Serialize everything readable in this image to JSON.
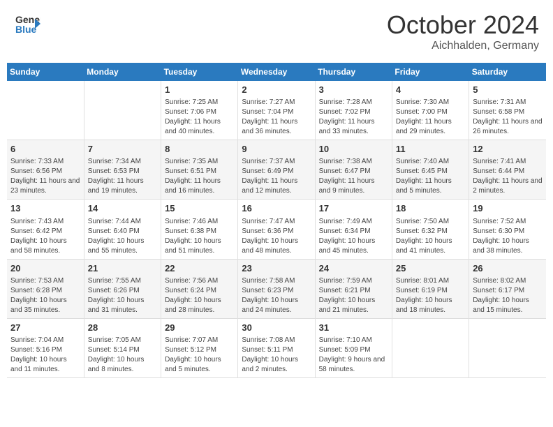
{
  "header": {
    "logo_general": "General",
    "logo_blue": "Blue",
    "title": "October 2024",
    "location": "Aichhalden, Germany"
  },
  "columns": [
    "Sunday",
    "Monday",
    "Tuesday",
    "Wednesday",
    "Thursday",
    "Friday",
    "Saturday"
  ],
  "weeks": [
    [
      {
        "day": "",
        "info": ""
      },
      {
        "day": "",
        "info": ""
      },
      {
        "day": "1",
        "info": "Sunrise: 7:25 AM\nSunset: 7:06 PM\nDaylight: 11 hours and 40 minutes."
      },
      {
        "day": "2",
        "info": "Sunrise: 7:27 AM\nSunset: 7:04 PM\nDaylight: 11 hours and 36 minutes."
      },
      {
        "day": "3",
        "info": "Sunrise: 7:28 AM\nSunset: 7:02 PM\nDaylight: 11 hours and 33 minutes."
      },
      {
        "day": "4",
        "info": "Sunrise: 7:30 AM\nSunset: 7:00 PM\nDaylight: 11 hours and 29 minutes."
      },
      {
        "day": "5",
        "info": "Sunrise: 7:31 AM\nSunset: 6:58 PM\nDaylight: 11 hours and 26 minutes."
      }
    ],
    [
      {
        "day": "6",
        "info": "Sunrise: 7:33 AM\nSunset: 6:56 PM\nDaylight: 11 hours and 23 minutes."
      },
      {
        "day": "7",
        "info": "Sunrise: 7:34 AM\nSunset: 6:53 PM\nDaylight: 11 hours and 19 minutes."
      },
      {
        "day": "8",
        "info": "Sunrise: 7:35 AM\nSunset: 6:51 PM\nDaylight: 11 hours and 16 minutes."
      },
      {
        "day": "9",
        "info": "Sunrise: 7:37 AM\nSunset: 6:49 PM\nDaylight: 11 hours and 12 minutes."
      },
      {
        "day": "10",
        "info": "Sunrise: 7:38 AM\nSunset: 6:47 PM\nDaylight: 11 hours and 9 minutes."
      },
      {
        "day": "11",
        "info": "Sunrise: 7:40 AM\nSunset: 6:45 PM\nDaylight: 11 hours and 5 minutes."
      },
      {
        "day": "12",
        "info": "Sunrise: 7:41 AM\nSunset: 6:44 PM\nDaylight: 11 hours and 2 minutes."
      }
    ],
    [
      {
        "day": "13",
        "info": "Sunrise: 7:43 AM\nSunset: 6:42 PM\nDaylight: 10 hours and 58 minutes."
      },
      {
        "day": "14",
        "info": "Sunrise: 7:44 AM\nSunset: 6:40 PM\nDaylight: 10 hours and 55 minutes."
      },
      {
        "day": "15",
        "info": "Sunrise: 7:46 AM\nSunset: 6:38 PM\nDaylight: 10 hours and 51 minutes."
      },
      {
        "day": "16",
        "info": "Sunrise: 7:47 AM\nSunset: 6:36 PM\nDaylight: 10 hours and 48 minutes."
      },
      {
        "day": "17",
        "info": "Sunrise: 7:49 AM\nSunset: 6:34 PM\nDaylight: 10 hours and 45 minutes."
      },
      {
        "day": "18",
        "info": "Sunrise: 7:50 AM\nSunset: 6:32 PM\nDaylight: 10 hours and 41 minutes."
      },
      {
        "day": "19",
        "info": "Sunrise: 7:52 AM\nSunset: 6:30 PM\nDaylight: 10 hours and 38 minutes."
      }
    ],
    [
      {
        "day": "20",
        "info": "Sunrise: 7:53 AM\nSunset: 6:28 PM\nDaylight: 10 hours and 35 minutes."
      },
      {
        "day": "21",
        "info": "Sunrise: 7:55 AM\nSunset: 6:26 PM\nDaylight: 10 hours and 31 minutes."
      },
      {
        "day": "22",
        "info": "Sunrise: 7:56 AM\nSunset: 6:24 PM\nDaylight: 10 hours and 28 minutes."
      },
      {
        "day": "23",
        "info": "Sunrise: 7:58 AM\nSunset: 6:23 PM\nDaylight: 10 hours and 24 minutes."
      },
      {
        "day": "24",
        "info": "Sunrise: 7:59 AM\nSunset: 6:21 PM\nDaylight: 10 hours and 21 minutes."
      },
      {
        "day": "25",
        "info": "Sunrise: 8:01 AM\nSunset: 6:19 PM\nDaylight: 10 hours and 18 minutes."
      },
      {
        "day": "26",
        "info": "Sunrise: 8:02 AM\nSunset: 6:17 PM\nDaylight: 10 hours and 15 minutes."
      }
    ],
    [
      {
        "day": "27",
        "info": "Sunrise: 7:04 AM\nSunset: 5:16 PM\nDaylight: 10 hours and 11 minutes."
      },
      {
        "day": "28",
        "info": "Sunrise: 7:05 AM\nSunset: 5:14 PM\nDaylight: 10 hours and 8 minutes."
      },
      {
        "day": "29",
        "info": "Sunrise: 7:07 AM\nSunset: 5:12 PM\nDaylight: 10 hours and 5 minutes."
      },
      {
        "day": "30",
        "info": "Sunrise: 7:08 AM\nSunset: 5:11 PM\nDaylight: 10 hours and 2 minutes."
      },
      {
        "day": "31",
        "info": "Sunrise: 7:10 AM\nSunset: 5:09 PM\nDaylight: 9 hours and 58 minutes."
      },
      {
        "day": "",
        "info": ""
      },
      {
        "day": "",
        "info": ""
      }
    ]
  ]
}
